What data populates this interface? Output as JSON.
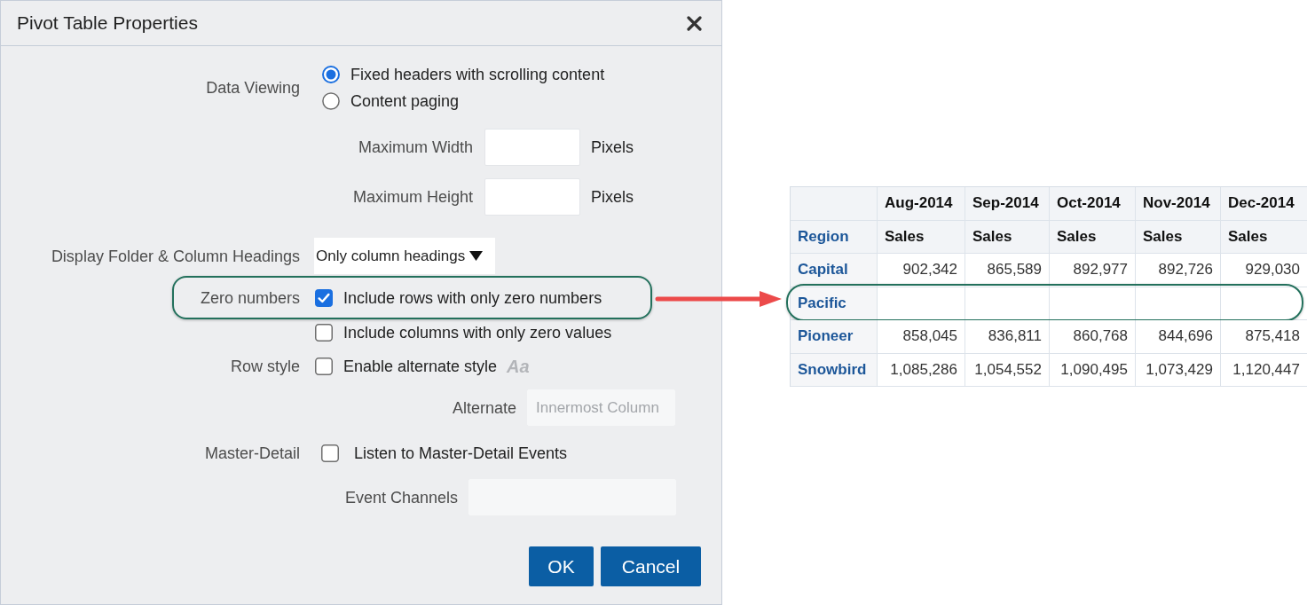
{
  "dialog": {
    "title": "Pivot Table Properties"
  },
  "data_viewing": {
    "label": "Data Viewing",
    "options": [
      {
        "label": "Fixed headers with scrolling content",
        "selected": true
      },
      {
        "label": "Content paging",
        "selected": false
      }
    ]
  },
  "size_fields": [
    {
      "label": "Maximum Width",
      "unit": "Pixels"
    },
    {
      "label": "Maximum Height",
      "unit": "Pixels"
    }
  ],
  "display_headings": {
    "label": "Display Folder & Column Headings",
    "value": "Only column headings"
  },
  "zero_numbers": {
    "label": "Zero numbers",
    "highlighted": true,
    "options": [
      {
        "label": "Include rows with only zero numbers",
        "checked": true
      },
      {
        "label": "Include columns with only zero values",
        "checked": false
      }
    ]
  },
  "row_style": {
    "label": "Row style",
    "option": {
      "label": "Enable alternate style",
      "checked": false
    },
    "style_glyph": "Aa",
    "alternate": {
      "label": "Alternate",
      "value": "Innermost Column",
      "disabled": true
    }
  },
  "master_detail": {
    "label": "Master-Detail",
    "option": {
      "label": "Listen to Master-Detail Events",
      "checked": false
    },
    "channels": {
      "label": "Event Channels",
      "disabled": true
    }
  },
  "buttons": [
    {
      "label": "OK"
    },
    {
      "label": "Cancel"
    }
  ],
  "pivot_table": {
    "columns": [
      "Aug-2014",
      "Sep-2014",
      "Oct-2014",
      "Nov-2014",
      "Dec-2014"
    ],
    "row_header": "Region",
    "measures": [
      "Sales",
      "Sales",
      "Sales",
      "Sales",
      "Sales"
    ],
    "rows": [
      {
        "region": "Capital",
        "highlighted": false,
        "values": [
          "902,342",
          "865,589",
          "892,977",
          "892,726",
          "929,030"
        ]
      },
      {
        "region": "Pacific",
        "highlighted": true
      },
      {
        "region": "Pioneer",
        "highlighted": false,
        "values": [
          "858,045",
          "836,811",
          "860,768",
          "844,696",
          "875,418"
        ]
      },
      {
        "region": "Snowbird",
        "highlighted": false,
        "values": [
          "1,085,286",
          "1,054,552",
          "1,090,495",
          "1,073,429",
          "1,120,447"
        ]
      }
    ]
  }
}
